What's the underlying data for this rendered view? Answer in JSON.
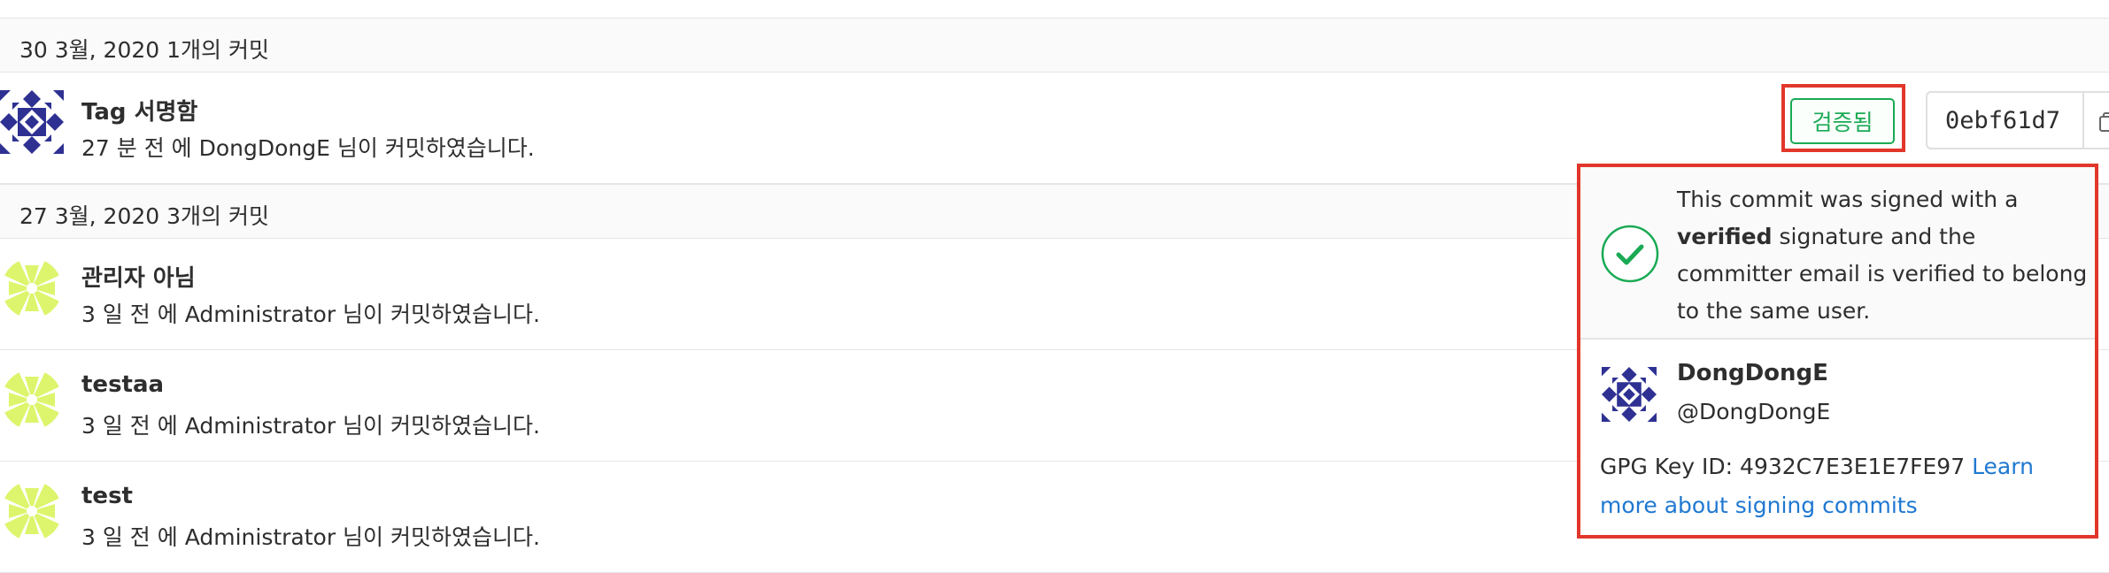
{
  "commit_groups": [
    {
      "header": "30 3월, 2020 1개의 커밋",
      "commits": [
        {
          "title": "Tag 서명함",
          "meta": "27 분 전 에 DongDongE 님이 커밋하였습니다.",
          "avatar": "dongdonge-identicon"
        }
      ]
    },
    {
      "header": "27 3월, 2020 3개의 커밋",
      "commits": [
        {
          "title": "관리자 아님",
          "meta": "3 일 전 에 Administrator 님이 커밋하였습니다.",
          "avatar": "administrator-identicon"
        },
        {
          "title": "testaa",
          "meta": "3 일 전 에 Administrator 님이 커밋하였습니다.",
          "avatar": "administrator-identicon"
        },
        {
          "title": "test",
          "meta": "3 일 전 에 Administrator 님이 커밋하였습니다.",
          "avatar": "administrator-identicon"
        }
      ]
    }
  ],
  "verification": {
    "badge_label": "검증됨",
    "sha": "0ebf61d7",
    "popover": {
      "line_prefix": "This commit was signed with a ",
      "bold_word": "verified",
      "line_suffix": " signature and the committer email is verified to belong to the same user.",
      "signer_name": "DongDongE",
      "signer_handle": "@DongDongE",
      "gpg_key_text": "GPG Key ID: 4932C7E3E1E7FE97 ",
      "learn_more_link": "Learn more about signing commits"
    }
  },
  "colors": {
    "verified_green": "#1aaa55",
    "highlight_red": "#e2362b",
    "link_blue": "#1f78d1",
    "dongdonge_avatar": "#2e3192",
    "admin_avatar": "#dcf56c"
  }
}
